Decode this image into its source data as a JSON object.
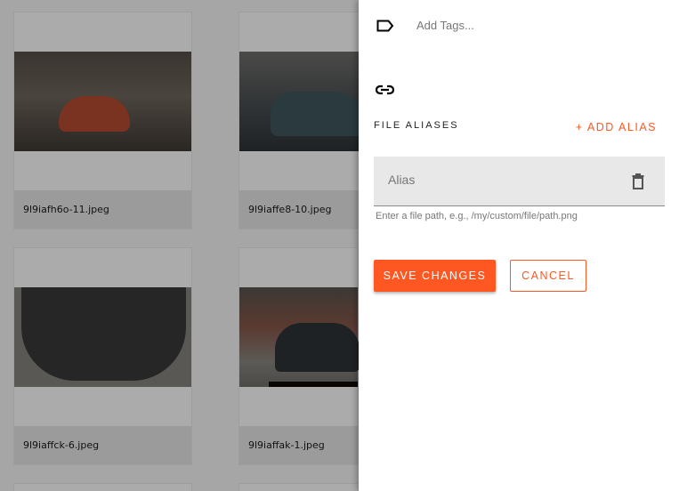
{
  "grid": {
    "cards": [
      {
        "filename": "9l9iafh6o-11.jpeg"
      },
      {
        "filename": "9l9iaffe8-10.jpeg"
      },
      {
        "filename": "9l9iaffck-6.jpeg"
      },
      {
        "filename": "9l9iaffak-1.jpeg"
      }
    ]
  },
  "panel": {
    "tags_placeholder": "Add Tags...",
    "aliases_label": "FILE ALIASES",
    "add_alias": "+ ADD ALIAS",
    "alias_placeholder": "Alias",
    "alias_value": "",
    "alias_help": "Enter a file path, e.g., /my/custom/file/path.png",
    "save": "SAVE CHANGES",
    "cancel": "CANCEL"
  },
  "colors": {
    "accent": "#ff5722"
  },
  "icons": {
    "tag": "tag-icon",
    "link": "link-icon",
    "delete": "trash-icon"
  }
}
